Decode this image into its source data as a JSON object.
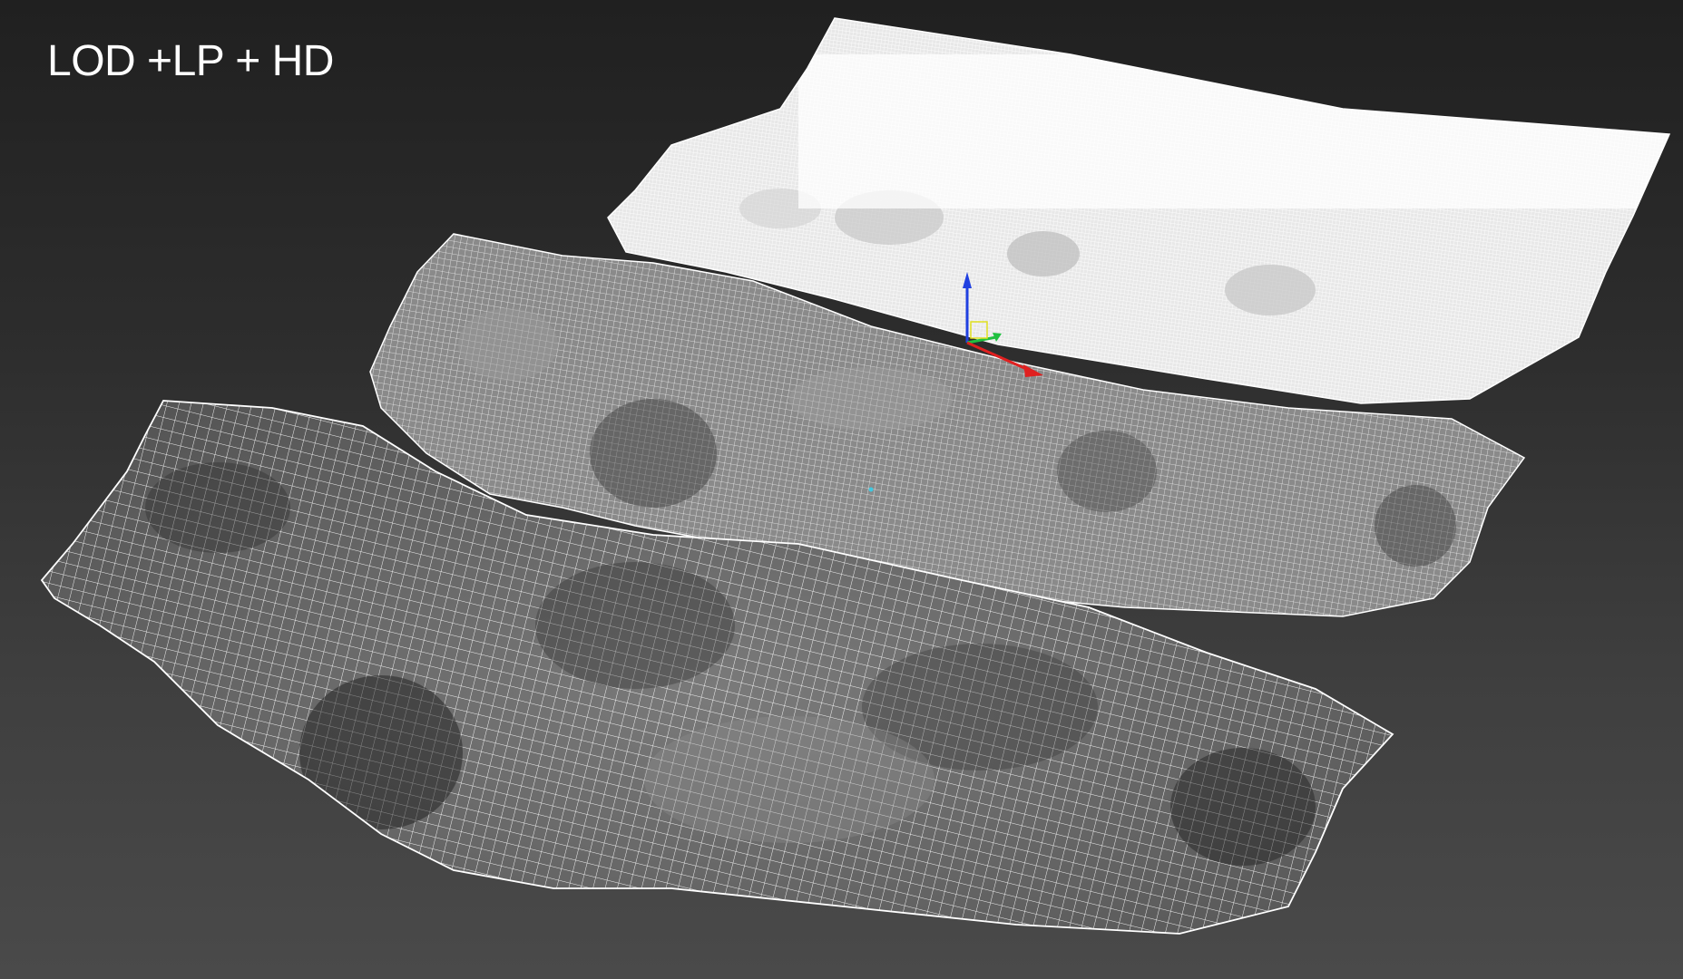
{
  "viewport": {
    "title": "LOD +LP + HD"
  },
  "models": [
    {
      "id": "hd",
      "icon": "mesh-hd-icon"
    },
    {
      "id": "lp",
      "icon": "mesh-lp-icon"
    },
    {
      "id": "lod",
      "icon": "mesh-lod-icon"
    }
  ],
  "gizmo": {
    "icon": "transform-gizmo-icon",
    "axis_colors": {
      "x": "#e02020",
      "y": "#20c040",
      "z": "#2040e0"
    }
  },
  "colors": {
    "wire": "#ffffff",
    "background_top": "#202020",
    "background_bottom": "#4a4a4a"
  }
}
